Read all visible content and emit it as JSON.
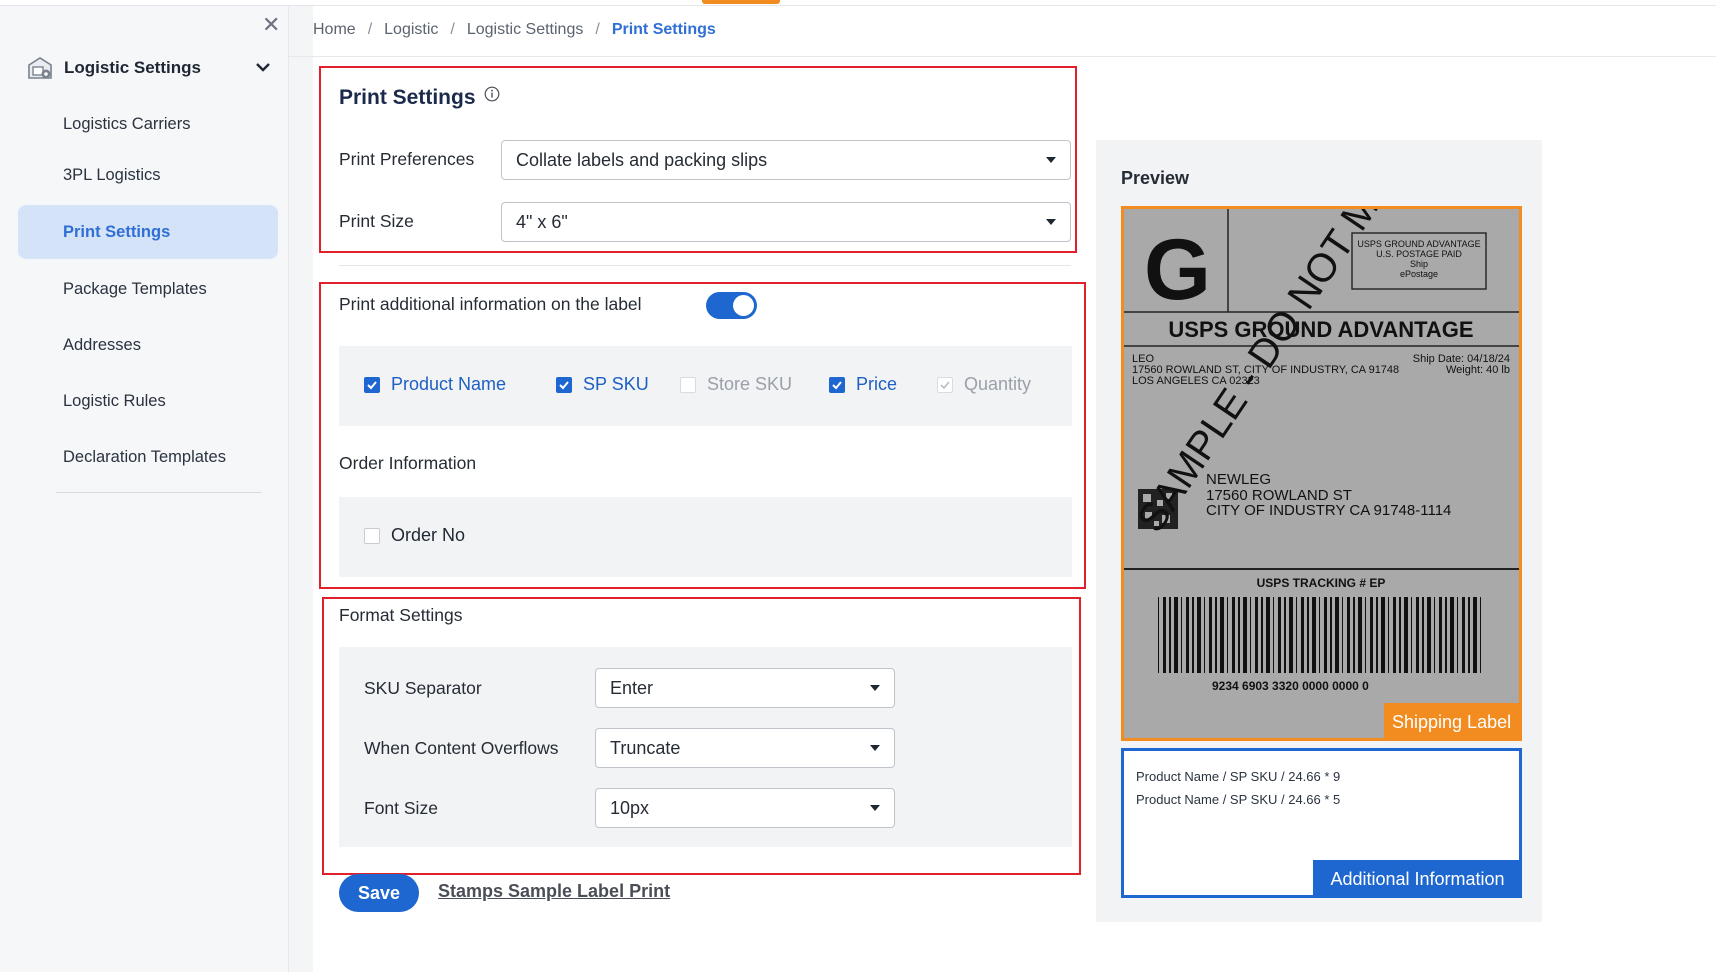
{
  "sidebar": {
    "header": "Logistic Settings",
    "items": [
      {
        "label": "Logistics Carriers",
        "active": false
      },
      {
        "label": "3PL Logistics",
        "active": false
      },
      {
        "label": "Print Settings",
        "active": true
      },
      {
        "label": "Package Templates",
        "active": false
      },
      {
        "label": "Addresses",
        "active": false
      },
      {
        "label": "Logistic Rules",
        "active": false
      },
      {
        "label": "Declaration Templates",
        "active": false
      }
    ]
  },
  "breadcrumb": [
    "Home",
    "Logistic",
    "Logistic Settings",
    "Print Settings"
  ],
  "print_settings": {
    "title": "Print Settings",
    "preferences_label": "Print Preferences",
    "preferences_value": "Collate labels and packing slips",
    "size_label": "Print Size",
    "size_value": "4\" x 6\""
  },
  "additional": {
    "toggle_label": "Print additional information on the label",
    "toggle_on": true,
    "fields": [
      {
        "label": "Product Name",
        "checked": true,
        "disabled": false
      },
      {
        "label": "SP SKU",
        "checked": true,
        "disabled": false
      },
      {
        "label": "Store SKU",
        "checked": false,
        "disabled": true
      },
      {
        "label": "Price",
        "checked": true,
        "disabled": false
      },
      {
        "label": "Quantity",
        "checked": true,
        "disabled": true
      }
    ],
    "order_info_title": "Order Information",
    "order_no_label": "Order No",
    "order_no_checked": false
  },
  "format": {
    "title": "Format Settings",
    "sku_separator_label": "SKU Separator",
    "sku_separator_value": "Enter",
    "overflow_label": "When Content Overflows",
    "overflow_value": "Truncate",
    "font_size_label": "Font Size",
    "font_size_value": "10px"
  },
  "actions": {
    "save_label": "Save",
    "sample_link": "Stamps Sample Label Print"
  },
  "preview": {
    "title": "Preview",
    "label": {
      "letter": "G",
      "box_text": [
        "USPS GROUND ADVANTAGE",
        "U.S. POSTAGE PAID",
        "Ship",
        "ePostage"
      ],
      "service": "USPS GROUND ADVANTAGE",
      "from_lines": [
        "LEO",
        "17560 ROWLAND ST, CITY OF INDUSTRY, CA 91748",
        "LOS ANGELES CA 02323"
      ],
      "ship_date": "Ship Date: 04/18/24",
      "weight": "Weight: 40 lb",
      "to_lines": [
        "NEWLEG",
        "17560 ROWLAND ST",
        "CITY OF INDUSTRY CA 91748-1114"
      ],
      "watermark": "SAMPLE - DO NOT MAIL",
      "tracking_title": "USPS TRACKING # EP",
      "tracking_number": "9234 6903 3320 0000 0000 0"
    },
    "shipping_label_tag": "Shipping Label",
    "additional_lines": [
      "Product Name / SP SKU / 24.66 * 9",
      "Product Name / SP SKU / 24.66 * 5"
    ],
    "additional_tag": "Additional Information"
  },
  "colors": {
    "primary": "#1e66d0",
    "accent": "#f28b20",
    "highlight_border": "#e0212b"
  }
}
